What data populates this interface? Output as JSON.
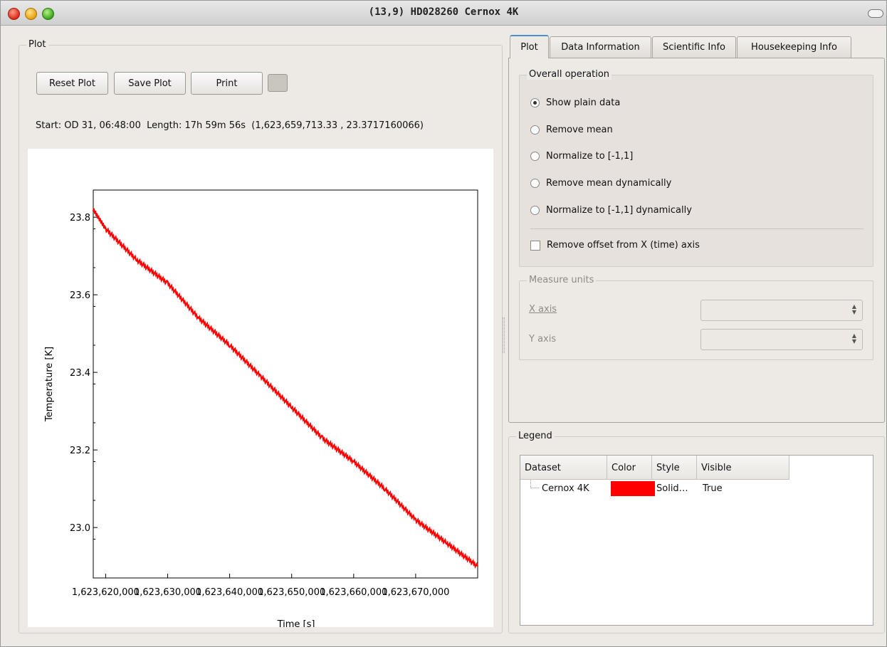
{
  "window": {
    "title": "(13,9) HD028260 Cernox 4K"
  },
  "plot_group": {
    "title": "Plot",
    "buttons": {
      "reset": "Reset Plot",
      "save": "Save Plot",
      "print": "Print"
    },
    "info": "Start: OD 31, 06:48:00  Length: 17h 59m 56s  (1,623,659,713.33 , 23.3717160066)"
  },
  "tabs": [
    {
      "label": "Plot",
      "active": true
    },
    {
      "label": "Data Information",
      "active": false
    },
    {
      "label": "Scientific Info",
      "active": false
    },
    {
      "label": "Housekeeping Info",
      "active": false
    }
  ],
  "overall_operation": {
    "title": "Overall operation",
    "options": [
      {
        "label": "Show plain data",
        "selected": true
      },
      {
        "label": "Remove mean",
        "selected": false
      },
      {
        "label": "Normalize to [-1,1]",
        "selected": false
      },
      {
        "label": "Remove mean dynamically",
        "selected": false
      },
      {
        "label": "Normalize to [-1,1] dynamically",
        "selected": false
      }
    ],
    "remove_offset": {
      "label": "Remove offset from X (time) axis",
      "checked": false
    }
  },
  "measure_units": {
    "title": "Measure units",
    "x_label": "X axis",
    "y_label": "Y axis",
    "x_value": "",
    "y_value": ""
  },
  "legend": {
    "title": "Legend",
    "columns": [
      "Dataset",
      "Color",
      "Style",
      "Visible"
    ],
    "rows": [
      {
        "dataset": "Cernox 4K",
        "color": "#ff0000",
        "style": "Solid…",
        "visible": "True"
      }
    ]
  },
  "chart_data": {
    "type": "line",
    "title": "",
    "xlabel": "Time [s]",
    "ylabel": "Temperature [K]",
    "xlim": [
      1623618000,
      1623680000
    ],
    "ylim": [
      22.87,
      23.87
    ],
    "xticks": [
      1623620000,
      1623630000,
      1623640000,
      1623650000,
      1623660000,
      1623670000
    ],
    "xtick_labels": [
      "1,623,620,000",
      "1,623,630,000",
      "1,623,640,000",
      "1,623,650,000",
      "1,623,660,000",
      "1,623,670,000"
    ],
    "yticks": [
      23.0,
      23.2,
      23.4,
      23.6,
      23.8
    ],
    "ytick_labels": [
      "23.0",
      "23.2",
      "23.4",
      "23.6",
      "23.8"
    ],
    "grid": false,
    "series": [
      {
        "color": "#ff0000",
        "x": [
          1623618000,
          1623620000,
          1623625000,
          1623630000,
          1623635000,
          1623640000,
          1623645000,
          1623650000,
          1623655000,
          1623660000,
          1623665000,
          1623670000,
          1623675000,
          1623680000
        ],
        "y": [
          23.82,
          23.77,
          23.69,
          23.63,
          23.54,
          23.47,
          23.39,
          23.31,
          23.23,
          23.17,
          23.1,
          23.02,
          22.96,
          22.9
        ]
      }
    ]
  }
}
